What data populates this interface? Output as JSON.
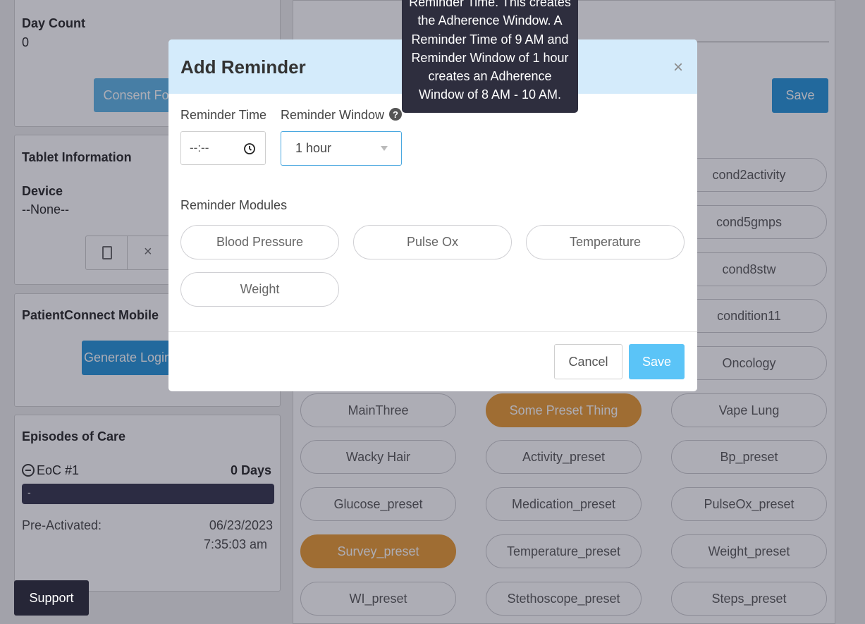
{
  "background": {
    "left": {
      "day_count_label": "Day Count",
      "day_count_value": "0",
      "consent_button": "Consent Fo",
      "tablet_title": "Tablet Information",
      "device_label": "Device",
      "device_value": "--None--",
      "tablet_close_glyph": "×",
      "mobile_title": "PatientConnect Mobile",
      "generate_login_button": "Generate Login",
      "episodes_title": "Episodes of Care",
      "eoc_label": "EoC #1",
      "eoc_days": "0 Days",
      "eoc_bar_text": "-",
      "pre_activated_label": "Pre-Activated:",
      "pre_activated_date": "06/23/2023",
      "pre_activated_time": "7:35:03 am"
    },
    "support_button": "Support",
    "right": {
      "save_button": "Save",
      "presets_right_col": [
        "cond2activity",
        "cond5gmps",
        "cond8stw",
        "condition11",
        "Oncology"
      ],
      "preset_rows": [
        [
          "MainThree",
          "Some Preset Thing",
          "Vape Lung"
        ],
        [
          "Wacky Hair",
          "Activity_preset",
          "Bp_preset"
        ],
        [
          "Glucose_preset",
          "Medication_preset",
          "PulseOx_preset"
        ],
        [
          "Survey_preset",
          "Temperature_preset",
          "Weight_preset"
        ],
        [
          "WI_preset",
          "Stethoscope_preset",
          "Steps_preset"
        ]
      ],
      "selected_presets": [
        "Some Preset Thing",
        "Survey_preset"
      ]
    }
  },
  "modal": {
    "title": "Add Reminder",
    "close_glyph": "×",
    "reminder_time_label": "Reminder Time",
    "reminder_time_value": "--:--",
    "reminder_window_label": "Reminder Window",
    "help_glyph": "?",
    "reminder_window_value": "1 hour",
    "modules_label": "Reminder Modules",
    "modules": [
      "Blood Pressure",
      "Pulse Ox",
      "Temperature",
      "Weight"
    ],
    "cancel_button": "Cancel",
    "save_button": "Save"
  },
  "tooltip": {
    "lines": [
      "Reminder Time. This creates",
      "the Adherence Window. A",
      "Reminder Time of 9 AM and",
      "Reminder Window of 1 hour",
      "creates an Adherence",
      "Window of 8 AM - 10 AM."
    ]
  },
  "colors": {
    "overlay": "#28283c",
    "selected_pill": "#e8982e",
    "primary_blue": "#1f92d8",
    "modal_header": "#d4ebfb",
    "modal_save": "#5bc4f7",
    "tooltip_bg": "#2e2e3e"
  }
}
